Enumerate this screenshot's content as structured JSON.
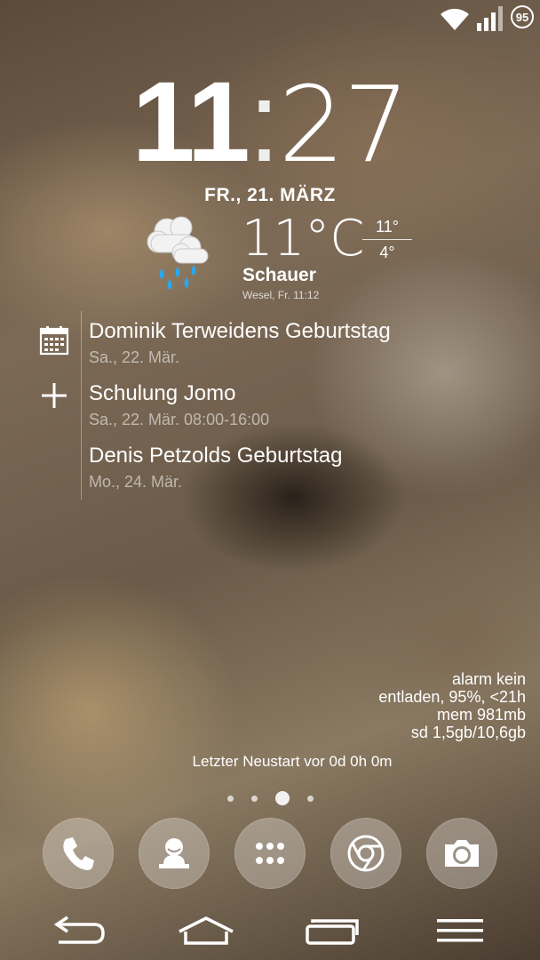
{
  "status_bar": {
    "battery_level": "95",
    "icons": [
      "wifi-icon",
      "signal-icon",
      "battery-icon"
    ]
  },
  "clock": {
    "hours": "11",
    "separator": ":",
    "minutes": "27",
    "date": "FR., 21. MÄRZ"
  },
  "weather": {
    "icon": "rain-cloud-icon",
    "temperature": "11°C",
    "high": "11°",
    "low": "4°",
    "condition": "Schauer",
    "location_time": "Wesel, Fr. 11:12"
  },
  "calendar": {
    "events": [
      {
        "title": "Dominik Terweidens Geburtstag",
        "date": "Sa., 22. Mär."
      },
      {
        "title": "Schulung Jomo",
        "date": "Sa., 22. Mär. 08:00-16:00"
      },
      {
        "title": "Denis Petzolds Geburtstag",
        "date": "Mo., 24. Mär."
      }
    ]
  },
  "system_info": {
    "alarm": "alarm kein",
    "battery": "entladen, 95%, <21h",
    "memory": "mem 981mb",
    "sd": "sd 1,5gb/10,6gb",
    "restart": "Letzter Neustart vor 0d 0h 0m"
  },
  "home": {
    "page_count": 4,
    "active_page": 3
  },
  "dock": [
    "phone-icon",
    "contacts-icon",
    "app-drawer-icon",
    "chrome-icon",
    "camera-icon"
  ],
  "nav_bar": [
    "back-icon",
    "home-icon",
    "recent-apps-icon",
    "menu-icon"
  ]
}
